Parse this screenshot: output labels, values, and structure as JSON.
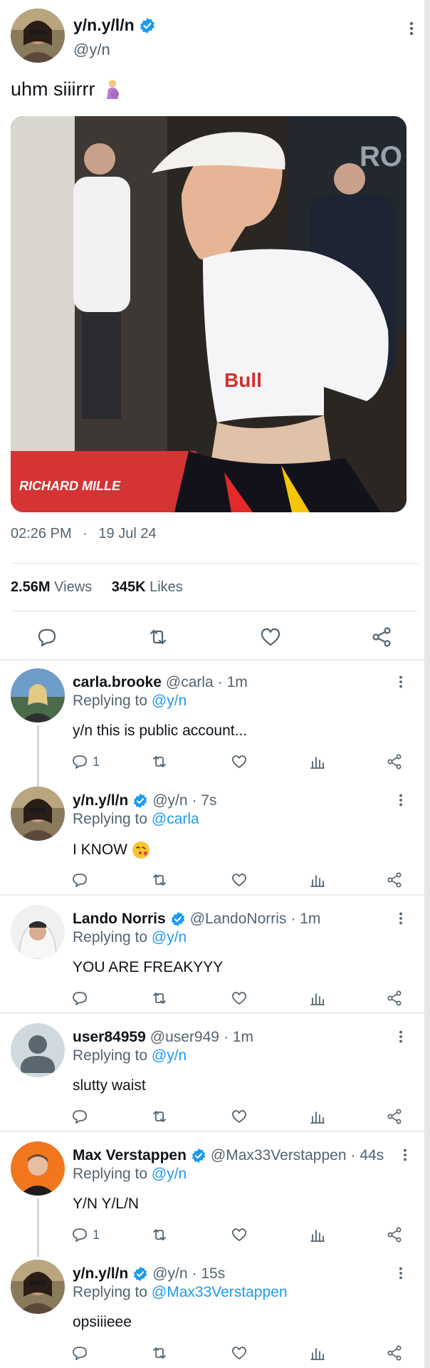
{
  "colors": {
    "accent": "#1d9bf0",
    "muted": "#536471",
    "text": "#0f1419"
  },
  "post": {
    "display_name": "y/n.y/l/n",
    "handle": "@y/n",
    "text": "uhm siiirrr",
    "text_emoji": "pregnant-person-emoji",
    "photo_caption_sign": "RICHARD MILLE",
    "time": "02:26 PM",
    "dot": "·",
    "date": "19 Jul 24",
    "views_count": "2.56M",
    "views_label": "Views",
    "likes_count": "345K",
    "likes_label": "Likes",
    "actions": [
      "reply-icon",
      "retweet-icon",
      "like-icon",
      "share-icon"
    ]
  },
  "replies": [
    {
      "display_name": "carla.brooke",
      "verified": false,
      "handle": "@carla",
      "time": "· 1m",
      "replying_label": "Replying to",
      "replying_to": "@y/n",
      "text": "y/n this is public account...",
      "reply_count": "1"
    },
    {
      "display_name": "y/n.y/l/n",
      "verified": true,
      "handle": "@y/n",
      "time": "· 7s",
      "replying_label": "Replying to",
      "replying_to": "@carla",
      "text": "I KNOW",
      "text_emoji": "face-blowing-kiss-emoji",
      "reply_count": ""
    },
    {
      "display_name": "Lando Norris",
      "verified": true,
      "handle": "@LandoNorris",
      "time": "· 1m",
      "replying_label": "Replying to",
      "replying_to": "@y/n",
      "text": "YOU ARE FREAKYYY",
      "reply_count": ""
    },
    {
      "display_name": "user84959",
      "verified": false,
      "handle": "@user949",
      "time": "· 1m",
      "replying_label": "Replying to",
      "replying_to": "@y/n",
      "text": "slutty waist",
      "reply_count": ""
    },
    {
      "display_name": "Max Verstappen",
      "verified": true,
      "handle": "@Max33Verstappen",
      "time": "· 44s",
      "replying_label": "Replying to",
      "replying_to": "@y/n",
      "text": "Y/N Y/L/N",
      "reply_count": "1"
    },
    {
      "display_name": "y/n.y/l/n",
      "verified": true,
      "handle": "@y/n",
      "time": "· 15s",
      "replying_label": "Replying to",
      "replying_to": "@Max33Verstappen",
      "text": "opsiiieee",
      "reply_count": ""
    }
  ]
}
